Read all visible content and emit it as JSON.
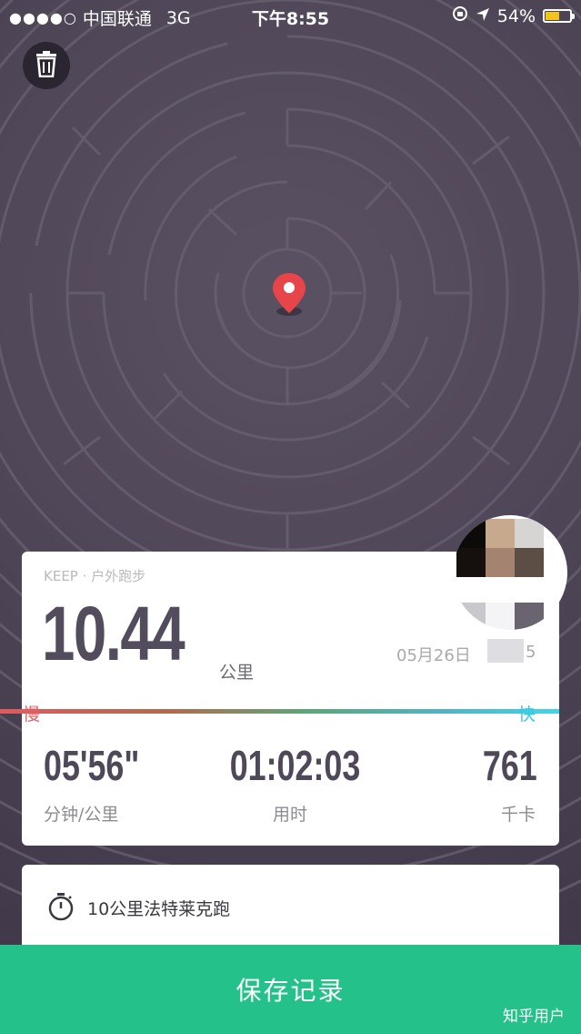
{
  "status_bar": {
    "signal_dots": "●●●●○",
    "carrier": "中国联通",
    "network": "3G",
    "time": "下午8:55",
    "battery_percent": "54%",
    "battery_level": 0.54
  },
  "map": {
    "marker_icon": "location-pin-icon",
    "delete_icon": "trash-icon"
  },
  "summary": {
    "category": "KEEP · 户外跑步",
    "distance": "10.44",
    "distance_unit": "公里",
    "date": "05月26日",
    "date_tail": "5",
    "slow_label": "慢",
    "fast_label": "快",
    "stats": [
      {
        "value": "05'56\"",
        "label": "分钟/公里"
      },
      {
        "value": "01:02:03",
        "label": "用时"
      },
      {
        "value": "761",
        "label": "千卡"
      }
    ]
  },
  "plan": {
    "icon": "stopwatch-icon",
    "name": "10公里法特莱克跑"
  },
  "footer": {
    "save_label": "保存记录",
    "watermark": "知乎用户"
  },
  "colors": {
    "save_button": "#24c28a",
    "slow": "#e06063",
    "fast": "#35c9e4",
    "marker": "#e8454a"
  }
}
